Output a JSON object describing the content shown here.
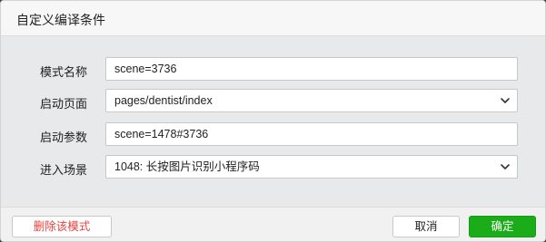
{
  "dialog": {
    "title": "自定义编译条件"
  },
  "form": {
    "mode_name": {
      "label": "模式名称",
      "value": "scene=3736"
    },
    "start_page": {
      "label": "启动页面",
      "value": "pages/dentist/index"
    },
    "start_params": {
      "label": "启动参数",
      "value": "scene=1478#3736"
    },
    "entry_scene": {
      "label": "进入场景",
      "value": "1048: 长按图片识别小程序码"
    }
  },
  "footer": {
    "delete_label": "删除该模式",
    "cancel_label": "取消",
    "confirm_label": "确定"
  },
  "colors": {
    "confirm_bg": "#1aad19",
    "delete_text": "#e64340"
  },
  "icons": {
    "select_chevron": "chevron-down-icon"
  }
}
